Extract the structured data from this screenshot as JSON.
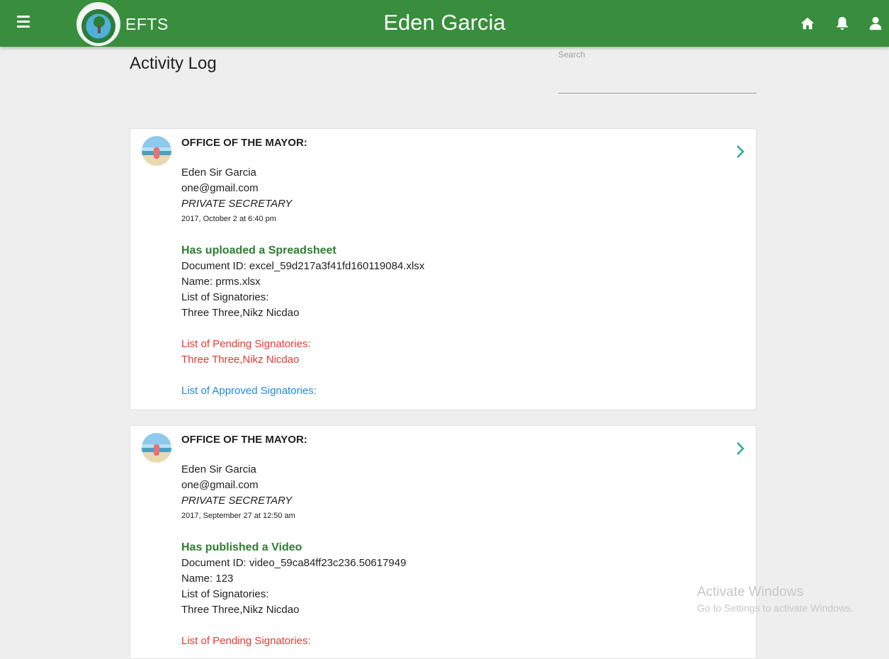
{
  "header": {
    "brand": "EFTS",
    "user_name": "Eden Garcia",
    "bg_color": "#388e3c"
  },
  "page": {
    "title": "Activity Log",
    "search_label": "Search",
    "search_value": ""
  },
  "entries": [
    {
      "office": "OFFICE OF THE MAYOR:",
      "name": "Eden Sir Garcia",
      "email": "one@gmail.com",
      "role": "PRIVATE SECRETARY",
      "date": "2017, October 2 at 6:40 pm",
      "action": "Has uploaded a Spreadsheet",
      "document_id": "Document ID: excel_59d217a3f41fd160119084.xlsx",
      "doc_name": "Name: prms.xlsx",
      "signatories_label": "List of Signatories:",
      "signatories": "Three Three,Nikz Nicdao",
      "pending_label": "List of Pending Signatories:",
      "pending": "Three Three,Nikz Nicdao",
      "approved_label": "List of Approved Signatories:"
    },
    {
      "office": "OFFICE OF THE MAYOR:",
      "name": "Eden Sir Garcia",
      "email": "one@gmail.com",
      "role": "PRIVATE SECRETARY",
      "date": "2017, September 27 at 12:50 am",
      "action": "Has published a Video",
      "document_id": "Document ID: video_59ca84ff23c236.50617949",
      "doc_name": "Name: 123",
      "signatories_label": "List of Signatories:",
      "signatories": "Three Three,Nikz Nicdao",
      "pending_label": "List of Pending Signatories:"
    }
  ],
  "watermark": {
    "line1": "Activate Windows",
    "line2": "Go to Settings to activate Windows."
  },
  "colors": {
    "action": "#2e7d32",
    "pending": "#e53935",
    "approved": "#1e88e5",
    "chevron": "#26a69a"
  },
  "icons": {
    "menu": "hamburger-menu-icon",
    "home": "home-icon",
    "bell": "bell-icon",
    "user": "user-icon",
    "chevron": "chevron-right-icon"
  }
}
